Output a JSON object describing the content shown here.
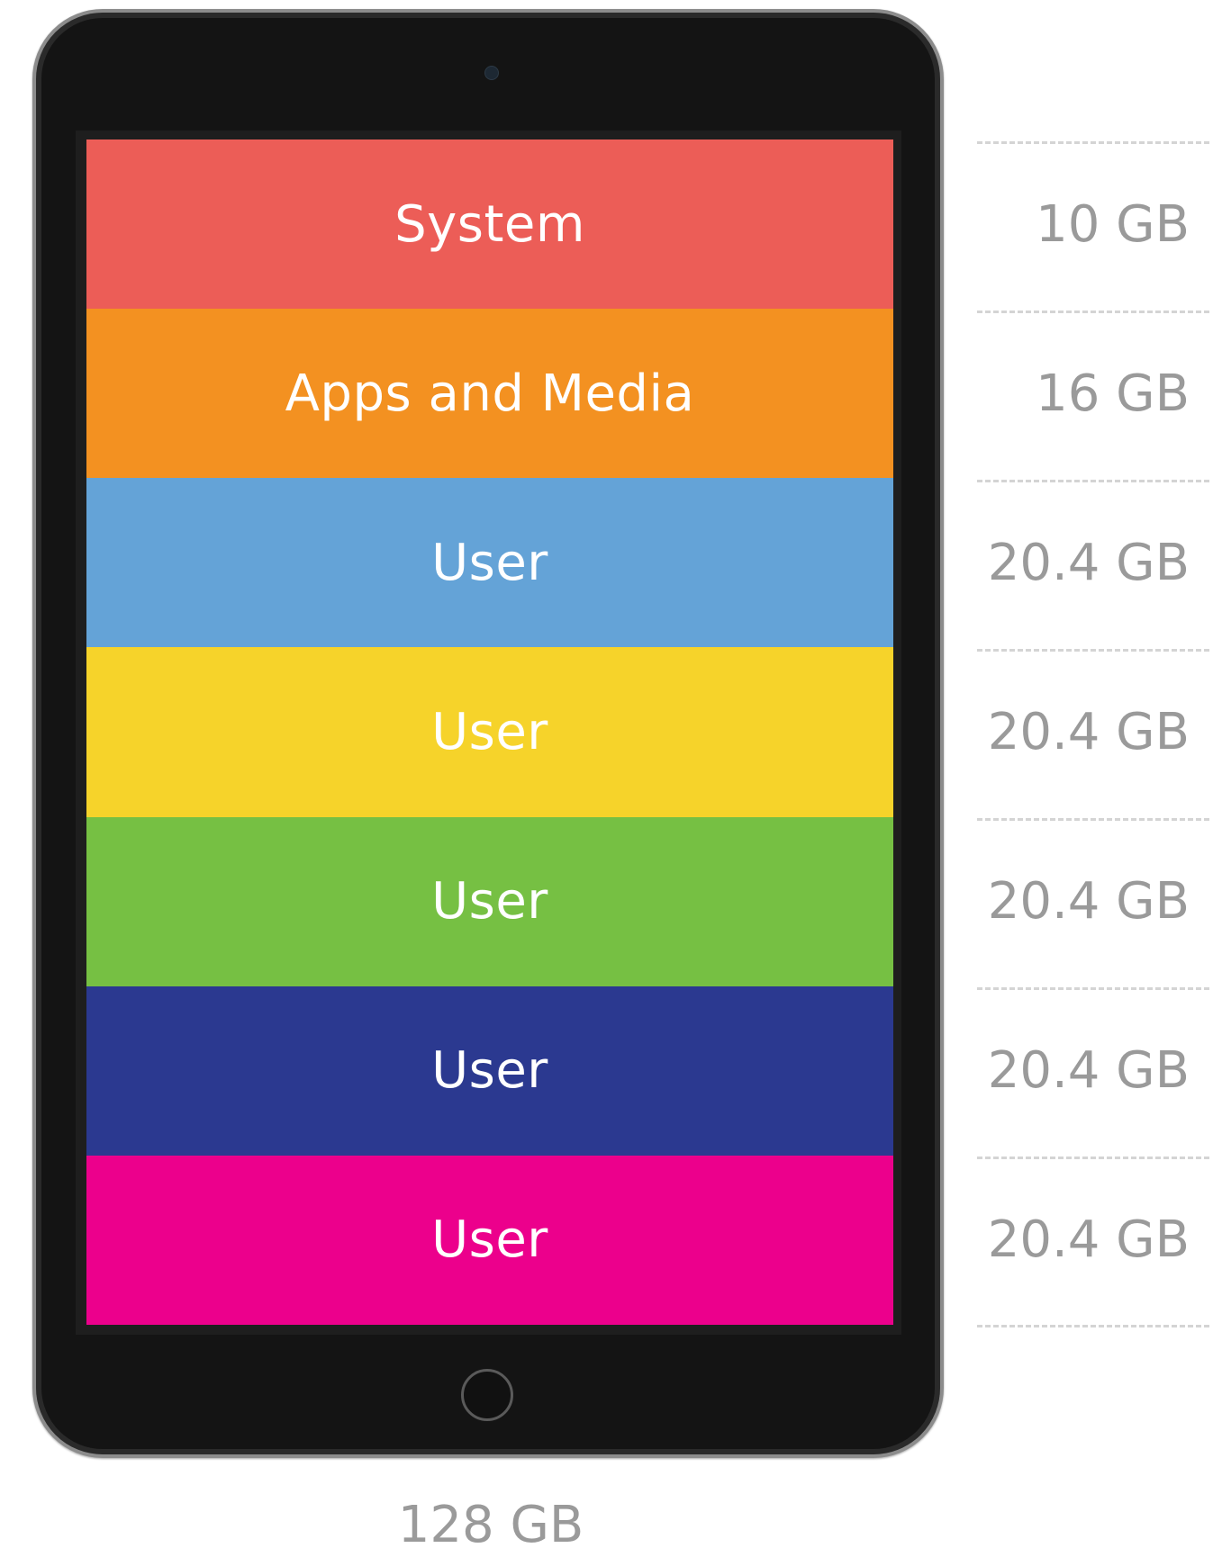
{
  "segments": [
    {
      "label": "System",
      "size": "10 GB",
      "color": "#ec5d57"
    },
    {
      "label": "Apps and Media",
      "size": "16 GB",
      "color": "#f39121"
    },
    {
      "label": "User",
      "size": "20.4 GB",
      "color": "#64a3d7"
    },
    {
      "label": "User",
      "size": "20.4 GB",
      "color": "#f6d32a"
    },
    {
      "label": "User",
      "size": "20.4 GB",
      "color": "#76c043"
    },
    {
      "label": "User",
      "size": "20.4 GB",
      "color": "#2b3990"
    },
    {
      "label": "User",
      "size": "20.4 GB",
      "color": "#ec008c"
    }
  ],
  "total": "128 GB",
  "icons": {
    "camera": "camera-icon",
    "home": "home-button-icon"
  }
}
